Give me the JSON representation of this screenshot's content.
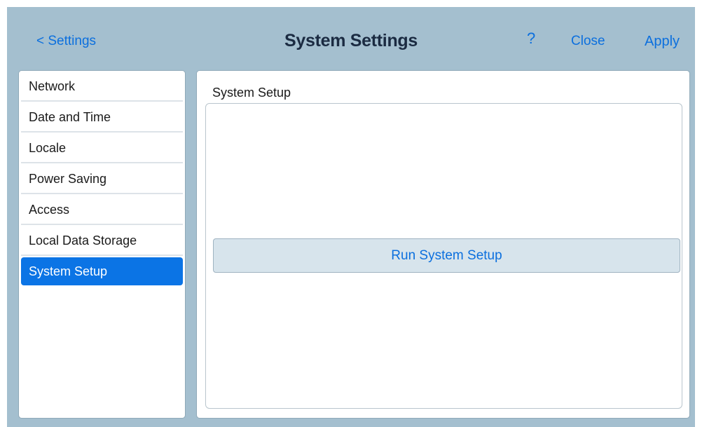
{
  "header": {
    "back_label": "< Settings",
    "title": "System Settings",
    "help_icon": "?",
    "close_label": "Close",
    "apply_label": "Apply"
  },
  "sidebar": {
    "items": [
      {
        "label": "Network",
        "selected": false
      },
      {
        "label": "Date and Time",
        "selected": false
      },
      {
        "label": "Locale",
        "selected": false
      },
      {
        "label": "Power Saving",
        "selected": false
      },
      {
        "label": "Access",
        "selected": false
      },
      {
        "label": "Local Data Storage",
        "selected": false
      },
      {
        "label": "System Setup",
        "selected": true
      }
    ]
  },
  "main": {
    "section_title": "System Setup",
    "run_button_label": "Run System Setup"
  },
  "colors": {
    "header_bg": "#a4bfcf",
    "accent": "#0b6fde",
    "selected_bg": "#0b74e5",
    "button_bg": "#d7e4ec"
  }
}
